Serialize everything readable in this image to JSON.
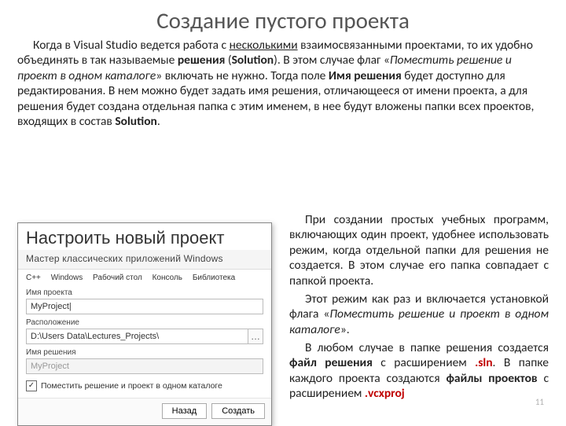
{
  "title": "Создание пустого проекта",
  "p1_pre": "Когда в Visual Studio ведется работа с ",
  "p1_und": "несколькими",
  "p1_a": " взаимосвязанными проектами, то их удобно объединять в так называемые ",
  "p1_b1": "решения",
  "p1_b": " (",
  "p1_b2": "Solution",
  "p1_c": "). В этом случае флаг «",
  "p1_it": "Поместить решение и проект в одном каталоге",
  "p1_d": "» включать не нужно. Тогда поле ",
  "p1_b3": "Имя решения",
  "p1_e": " будет доступно для редактирования. В нем можно будет задать имя решения, отличающееся от имени проекта, а для решения будет создана отдельная папка с этим именем, в нее будут вложены папки всех проектов, входящих в состав ",
  "p1_b4": "Solution",
  "p1_f": ".",
  "r1": "При создании простых учебных программ, включающих один проект, удобнее использовать режим, когда отдельной папки для решения не создается. В этом случае его папка совпадает с папкой проекта.",
  "r2_a": "Этот режим как раз и включается установкой флага «",
  "r2_it": "Поместить решение и проект в одном каталоге",
  "r2_b": "».",
  "r3_a": "В любом случае в папке решения создается ",
  "r3_b1": "файл решения",
  "r3_b": " с расширением ",
  "r3_ext1": ".sln",
  "r3_c": ". В папке каждого проекта создаются ",
  "r3_b2": "файлы проектов",
  "r3_d": " с расширением ",
  "r3_ext2": ".vcxproj",
  "dialog": {
    "title": "Настроить новый проект",
    "sub": "Мастер классических приложений Windows",
    "crumbs": [
      "C++",
      "Windows",
      "Рабочий стол",
      "Консоль",
      "Библиотека"
    ],
    "lbl_project": "Имя проекта",
    "val_project": "MyProject|",
    "lbl_loc": "Расположение",
    "val_loc": "D:\\Users Data\\Lectures_Projects\\",
    "lbl_sol": "Имя решения",
    "val_sol": "MyProject",
    "check": "Поместить решение и проект в одном каталоге",
    "btn_back": "Назад",
    "btn_create": "Создать"
  },
  "page": "11"
}
